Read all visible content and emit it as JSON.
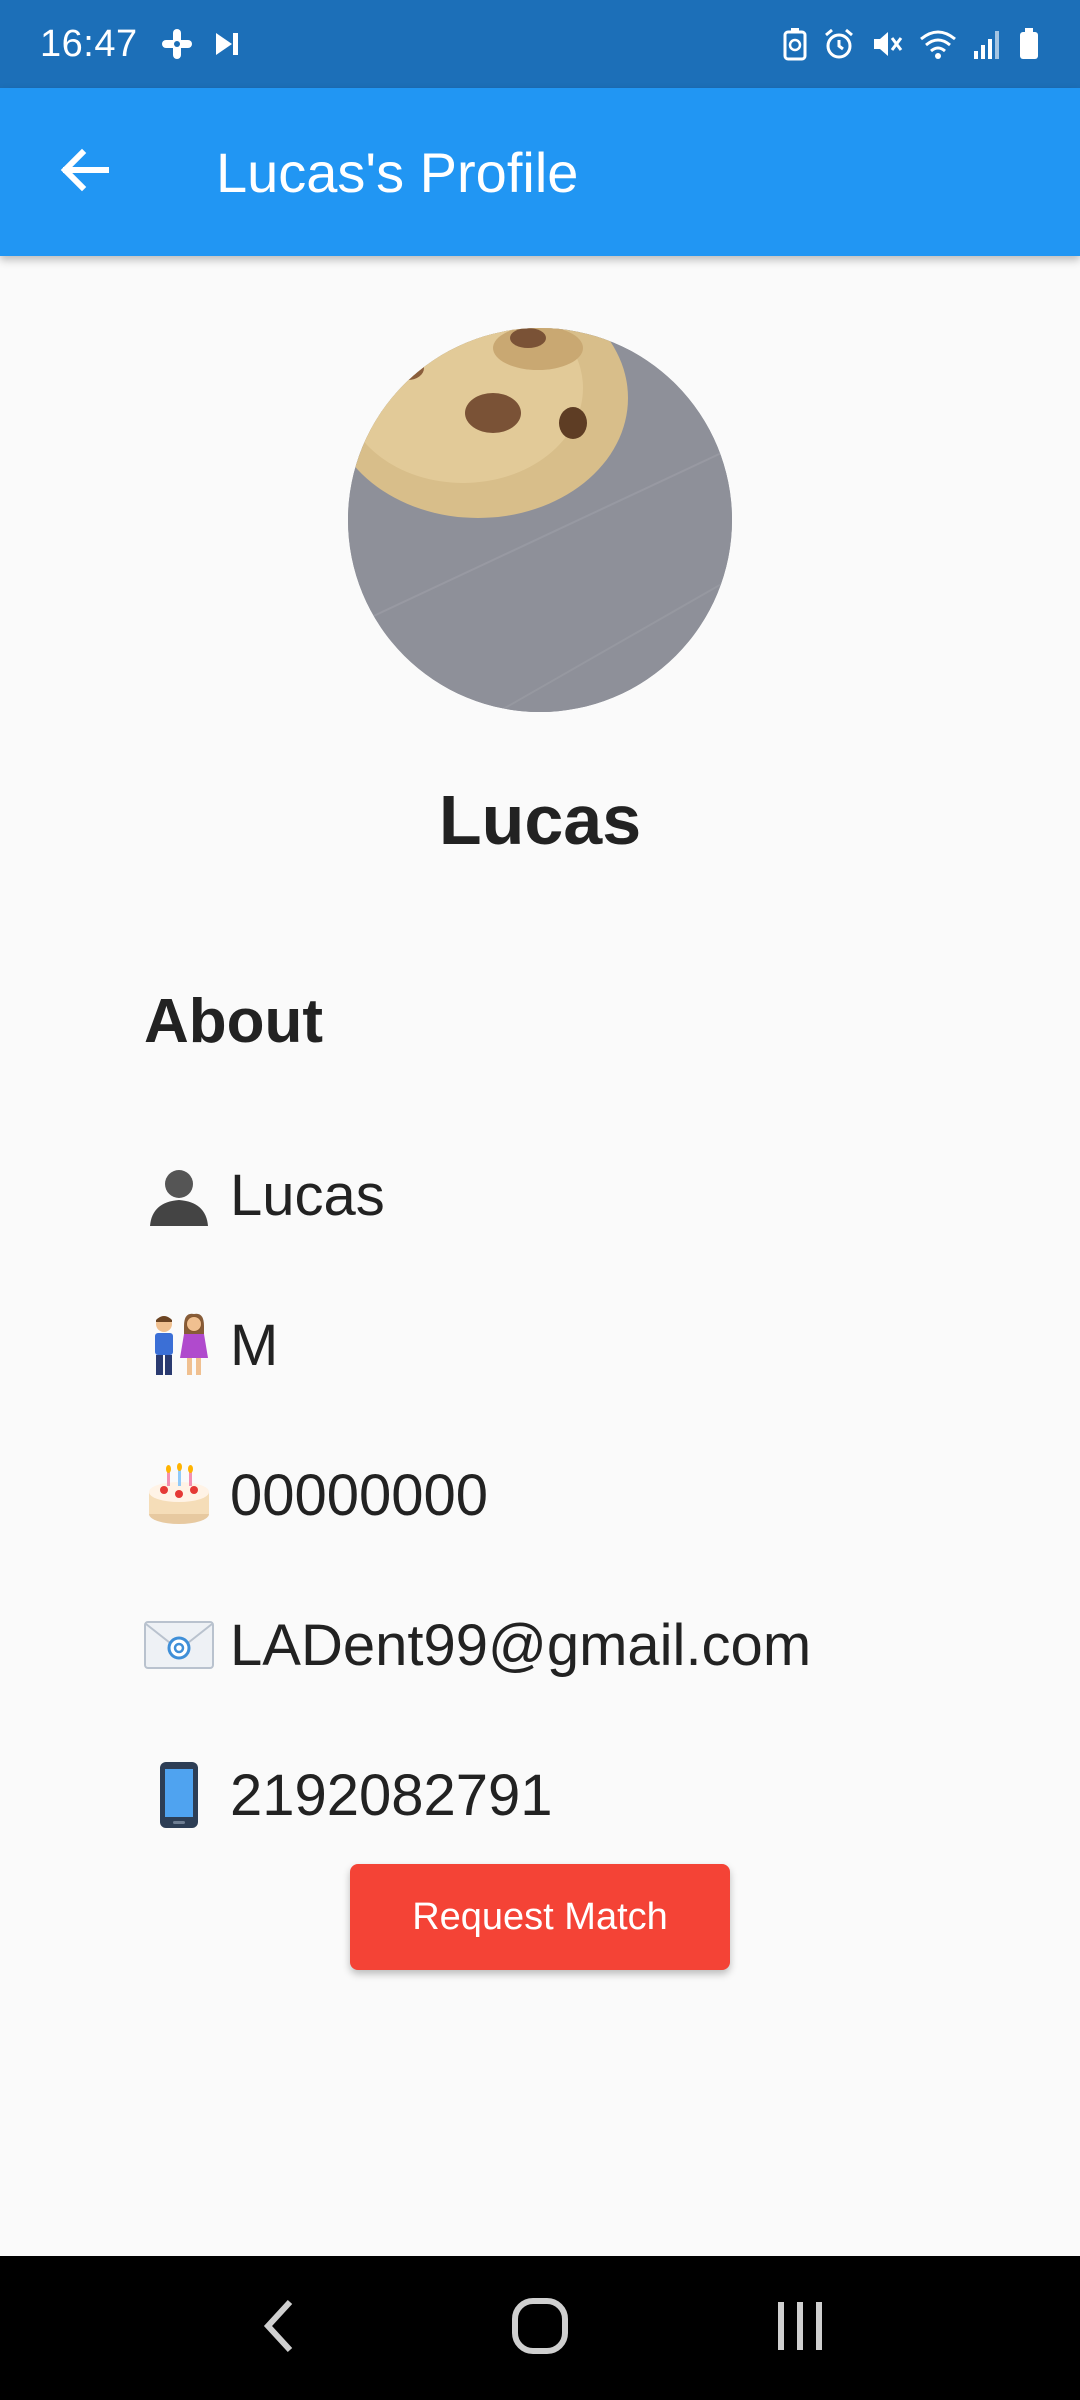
{
  "status_bar": {
    "time": "16:47",
    "left_icons": [
      "slack-icon",
      "media-next-icon"
    ],
    "right_icons": [
      "battery-saver-icon",
      "alarm-icon",
      "mute-icon",
      "wifi-icon",
      "signal-icon",
      "battery-icon"
    ]
  },
  "app_bar": {
    "title": "Lucas's Profile",
    "back_icon": "arrow-back-icon"
  },
  "profile": {
    "name": "Lucas",
    "avatar": "cookie-photo"
  },
  "about": {
    "title": "About",
    "rows": [
      {
        "icon": "bust-silhouette-emoji",
        "value": "Lucas"
      },
      {
        "icon": "couple-emoji",
        "value": "M"
      },
      {
        "icon": "birthday-cake-emoji",
        "value": "00000000"
      },
      {
        "icon": "email-envelope-emoji",
        "value": "LADent99@gmail.com"
      },
      {
        "icon": "mobile-phone-emoji",
        "value": "2192082791"
      }
    ]
  },
  "actions": {
    "request_match_label": "Request Match",
    "request_match_color": "#F44336"
  },
  "colors": {
    "status_bar": "#1C6FB8",
    "app_bar": "#2196F3",
    "background": "#FAFAFA"
  },
  "nav_bar": {
    "buttons": [
      "back-nav-icon",
      "home-nav-icon",
      "recents-nav-icon"
    ]
  }
}
